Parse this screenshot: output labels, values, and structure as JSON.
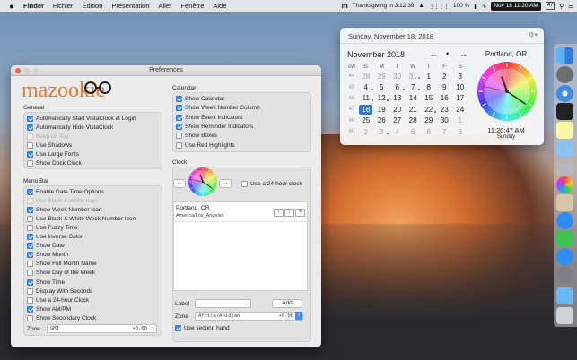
{
  "menubar": {
    "app_name": "Finder",
    "menus": [
      "Fichier",
      "Édition",
      "Présentation",
      "Aller",
      "Fenêtre",
      "Aide"
    ],
    "countdown": "Thanksgiving in 3:12:39",
    "battery": "100 %",
    "clock": "Nov 18 11:20 AM",
    "day_of_year": "47"
  },
  "prefs": {
    "title": "Preferences",
    "logo": "mazookie",
    "general": {
      "heading": "General",
      "items": [
        {
          "label": "Automatically Start VistaClock at Login",
          "checked": true,
          "disabled": false
        },
        {
          "label": "Automatically Hide VistaClock",
          "checked": true,
          "disabled": false
        },
        {
          "label": "Keep on Top",
          "checked": false,
          "disabled": true
        },
        {
          "label": "Use Shadows",
          "checked": false,
          "disabled": false
        },
        {
          "label": "Use Large Fonts",
          "checked": true,
          "disabled": false
        },
        {
          "label": "Show Dock Clock",
          "checked": false,
          "disabled": false
        }
      ]
    },
    "menubar_group": {
      "heading": "Menu Bar",
      "items": [
        {
          "label": "Enable Date Time Options",
          "checked": true,
          "disabled": false
        },
        {
          "label": "Use Black & White Icon",
          "checked": false,
          "disabled": true
        },
        {
          "label": "Show Week Number Icon",
          "checked": true,
          "disabled": false
        },
        {
          "label": "Use Black & White Week Number Icon",
          "checked": false,
          "disabled": false
        },
        {
          "label": "Use Fuzzy Time",
          "checked": false,
          "disabled": false
        },
        {
          "label": "Use Inverse Color",
          "checked": true,
          "disabled": false
        },
        {
          "label": "Show Date",
          "checked": true,
          "disabled": false
        },
        {
          "label": "Show Month",
          "checked": true,
          "disabled": false
        },
        {
          "label": "Show Full Month Name",
          "checked": false,
          "disabled": false
        },
        {
          "label": "Show Day of the Week",
          "checked": false,
          "disabled": false
        },
        {
          "label": "Show Time",
          "checked": true,
          "disabled": false
        },
        {
          "label": "Display With Seconds",
          "checked": false,
          "disabled": false
        },
        {
          "label": "Use a 24-hour Clock",
          "checked": false,
          "disabled": false
        },
        {
          "label": "Show AM/PM",
          "checked": true,
          "disabled": false
        },
        {
          "label": "Show Secondary Clock",
          "checked": false,
          "disabled": false
        }
      ],
      "zone_label": "Zone",
      "zone_value": "GMT",
      "zone_offset": "+0.00"
    },
    "calendar_group": {
      "heading": "Calendar",
      "items": [
        {
          "label": "Show Calendar",
          "checked": true
        },
        {
          "label": "Show Week Number Column",
          "checked": true
        },
        {
          "label": "Show Event Indicators",
          "checked": true
        },
        {
          "label": "Show Reminder Indicators",
          "checked": true
        },
        {
          "label": "Show Boxes",
          "checked": false
        },
        {
          "label": "Use Red Highlights",
          "checked": false
        }
      ]
    },
    "clock_group": {
      "heading": "Clock",
      "use_24h_label": "Use a 24-hour clock",
      "entry_city": "Portland, OR",
      "entry_tz": "America/Los_Angeles",
      "label_label": "Label",
      "label_value": "",
      "add_button": "Add",
      "zone_label": "Zone",
      "zone_value": "Africa/Abidjan",
      "zone_offset": "+0.00",
      "second_hand_label": "Use second hand"
    }
  },
  "calendar": {
    "header_date": "Sunday, November 18, 2018",
    "month_title": "November 2018",
    "city": "Portland, OR",
    "time": "11:20:47 AM",
    "weekday": "Sunday",
    "clock_time": {
      "hour": 11,
      "minute": 20,
      "second": 47
    },
    "days_of_week": [
      "S",
      "M",
      "T",
      "W",
      "T",
      "F",
      "S"
    ],
    "week_header": "cw",
    "weeks": [
      {
        "wk": "44",
        "days": [
          "28",
          "29",
          "30",
          "31",
          "1",
          "2",
          "3"
        ]
      },
      {
        "wk": "45",
        "days": [
          "4",
          "5",
          "6",
          "7",
          "8",
          "9",
          "10"
        ]
      },
      {
        "wk": "46",
        "days": [
          "11",
          "12",
          "13",
          "14",
          "15",
          "16",
          "17"
        ]
      },
      {
        "wk": "47",
        "days": [
          "18",
          "19",
          "20",
          "21",
          "22",
          "23",
          "24"
        ]
      },
      {
        "wk": "48",
        "days": [
          "25",
          "26",
          "27",
          "28",
          "29",
          "30",
          "1"
        ]
      },
      {
        "wk": "49",
        "days": [
          "2",
          "3",
          "4",
          "5",
          "6",
          "7",
          "8"
        ]
      }
    ]
  },
  "colors": {
    "accent": "#3a8ef6",
    "logo_orange": "#e8792b",
    "today_blue": "#2f79d8"
  }
}
